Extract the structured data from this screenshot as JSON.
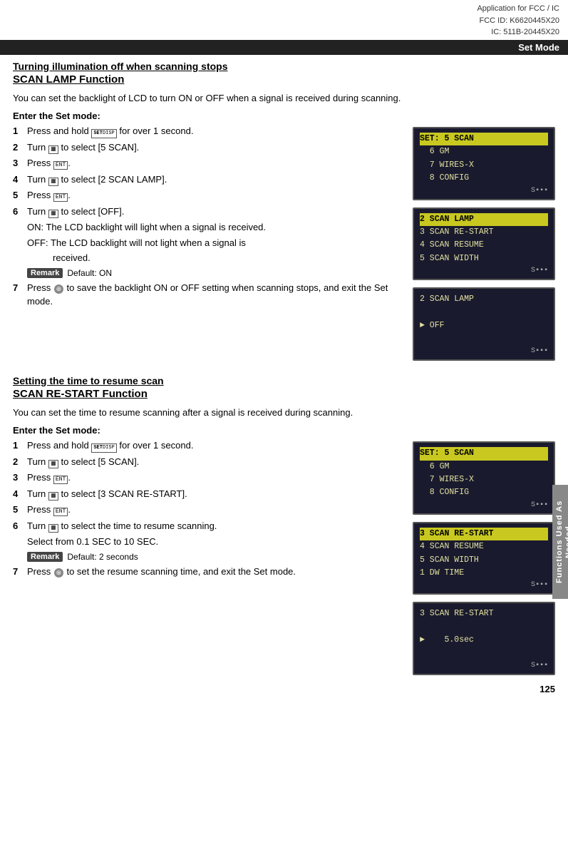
{
  "header": {
    "line1": "Application for FCC / IC",
    "line2": "FCC ID: K6620445X20",
    "line3": "IC: 511B-20445X20",
    "set_mode": "Set Mode"
  },
  "section1": {
    "title": "Turning illumination off when scanning stops",
    "subtitle": "SCAN LAMP Function",
    "description": "You can set the backlight of LCD to turn ON or OFF when a signal is received during scanning.",
    "enter_set_mode": "Enter the Set mode:",
    "steps": [
      {
        "num": "1",
        "text": "Press and hold",
        "icon": "SET/DISP",
        "text2": "for over 1 second."
      },
      {
        "num": "2",
        "text": "Turn",
        "icon": "DIAL",
        "text2": "to select [5 SCAN]."
      },
      {
        "num": "3",
        "text": "Press",
        "icon": "ENT",
        "text2": "."
      },
      {
        "num": "4",
        "text": "Turn",
        "icon": "DIAL",
        "text2": "to select [2 SCAN LAMP]."
      },
      {
        "num": "5",
        "text": "Press",
        "icon": "ENT",
        "text2": "."
      },
      {
        "num": "6",
        "text": "Turn",
        "icon": "DIAL",
        "text2": "to select [OFF]."
      }
    ],
    "step6_on": "ON: The LCD backlight will light when a signal is received.",
    "step6_off_1": "OFF: The LCD backlight will not light when a signal is",
    "step6_off_2": "received.",
    "remark_label": "Remark",
    "remark_text": "Default: ON",
    "step7_text": "Press",
    "step7_icon": "PTT",
    "step7_text2": "to save the backlight ON or OFF setting when scanning stops, and exit the Set mode.",
    "screens": [
      {
        "lines": [
          {
            "text": "SET: 5 SCAN",
            "highlight": true
          },
          {
            "text": "  6 GM",
            "highlight": false
          },
          {
            "text": "  7 WIRES-X",
            "highlight": false
          },
          {
            "text": "  8 CONFIG",
            "highlight": false
          }
        ],
        "signal": "S▪▪▪"
      },
      {
        "lines": [
          {
            "text": "2 SCAN LAMP",
            "highlight": true
          },
          {
            "text": "3 SCAN RE-START",
            "highlight": false
          },
          {
            "text": "4 SCAN RESUME",
            "highlight": false
          },
          {
            "text": "5 SCAN WIDTH",
            "highlight": false
          }
        ],
        "signal": "S▪▪▪"
      },
      {
        "lines": [
          {
            "text": "2 SCAN LAMP",
            "highlight": false
          },
          {
            "text": "",
            "highlight": false
          },
          {
            "text": "► OFF",
            "highlight": false
          }
        ],
        "signal": "S▪▪▪"
      }
    ]
  },
  "section2": {
    "title": "Setting the time to resume scan",
    "subtitle": "SCAN RE-START Function",
    "description": "You can set the time to resume scanning after a signal is received during scanning.",
    "enter_set_mode": "Enter the Set mode:",
    "steps": [
      {
        "num": "1",
        "text": "Press and hold",
        "icon": "SET/DISP",
        "text2": "for over 1 second."
      },
      {
        "num": "2",
        "text": "Turn",
        "icon": "DIAL",
        "text2": "to select [5 SCAN]."
      },
      {
        "num": "3",
        "text": "Press",
        "icon": "ENT",
        "text2": "."
      },
      {
        "num": "4",
        "text": "Turn",
        "icon": "DIAL",
        "text2": "to select [3 SCAN RE-START]."
      },
      {
        "num": "5",
        "text": "Press",
        "icon": "ENT",
        "text2": "."
      },
      {
        "num": "6",
        "text": "Turn",
        "icon": "DIAL",
        "text2": "to select the time to resume scanning."
      }
    ],
    "step6_select": "Select from 0.1 SEC to 10 SEC.",
    "remark_label": "Remark",
    "remark_text": "Default: 2 seconds",
    "step7_text": "Press",
    "step7_icon": "PTT",
    "step7_text2": "to set the resume scanning time, and exit the Set mode.",
    "screens": [
      {
        "lines": [
          {
            "text": "SET: 5 SCAN",
            "highlight": true
          },
          {
            "text": "  6 GM",
            "highlight": false
          },
          {
            "text": "  7 WIRES-X",
            "highlight": false
          },
          {
            "text": "  8 CONFIG",
            "highlight": false
          }
        ],
        "signal": "S▪▪▪"
      },
      {
        "lines": [
          {
            "text": "3 SCAN RE-START",
            "highlight": true
          },
          {
            "text": "4 SCAN RESUME",
            "highlight": false
          },
          {
            "text": "5 SCAN WIDTH",
            "highlight": false
          },
          {
            "text": "1 DW TIME",
            "highlight": false
          }
        ],
        "signal": "S▪▪▪"
      },
      {
        "lines": [
          {
            "text": "3 SCAN RE-START",
            "highlight": false
          },
          {
            "text": "",
            "highlight": false
          },
          {
            "text": "►    5.0sec",
            "highlight": false
          }
        ],
        "signal": "S▪▪▪"
      }
    ]
  },
  "side_tab": "Functions Used As Needed",
  "page_number": "125"
}
